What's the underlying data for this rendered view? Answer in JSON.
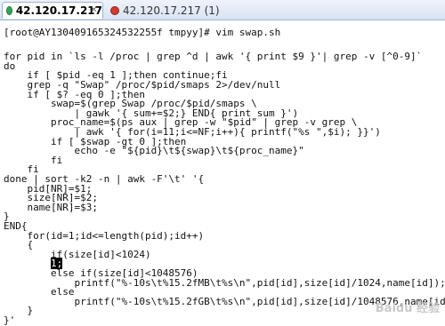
{
  "tabs": [
    {
      "label": "42.120.17.217",
      "status": "connected",
      "color": "#2fa84f"
    },
    {
      "label": "42.120.17.217 (1)",
      "status": "disconnected",
      "color": "#d23a2f"
    }
  ],
  "terminal": {
    "lines": [
      "[root@AY130409165324532255f tmpyy]# vim swap.sh",
      "",
      "for pid in `ls -l /proc | grep ^d | awk '{ print $9 }'| grep -v [^0-9]`",
      "do",
      "    if [ $pid -eq 1 ];then continue;fi",
      "    grep -q \"Swap\" /proc/$pid/smaps 2>/dev/null",
      "    if [ $? -eq 0 ];then",
      "        swap=$(grep Swap /proc/$pid/smaps \\",
      "            | gawk '{ sum+=$2;} END{ print sum }')",
      "        proc_name=$(ps aux | grep -w \"$pid\" | grep -v grep \\",
      "            | awk '{ for(i=11;i<=NF;i++){ printf(\"%s \",$i); }}')",
      "        if [ $swap -gt 0 ];then",
      "            echo -e \"${pid}\\t${swap}\\t${proc_name}\"",
      "        fi",
      "    fi",
      "done | sort -k2 -n | awk -F'\\t' '{",
      "    pid[NR]=$1;",
      "    size[NR]=$2;",
      "    name[NR]=$3;",
      "}",
      "END{",
      "    for(id=1;id<=length(pid);id++)",
      "    {",
      "        if(size[id]<1024)",
      "        ",
      "        else if(size[id]<1048576)",
      "            printf(\"%-10s\\t%15.2fMB\\t%s\\n\",pid[id],size[id]/1024,name[id]);",
      "        else",
      "            printf(\"%-10s\\t%15.2fGB\\t%s\\n\",pid[id],size[id]/1048576,name[id]);",
      "    }",
      "}'"
    ],
    "cursor_line": 24,
    "cursor_text": "1;"
  },
  "watermark": "Baidu 经验"
}
